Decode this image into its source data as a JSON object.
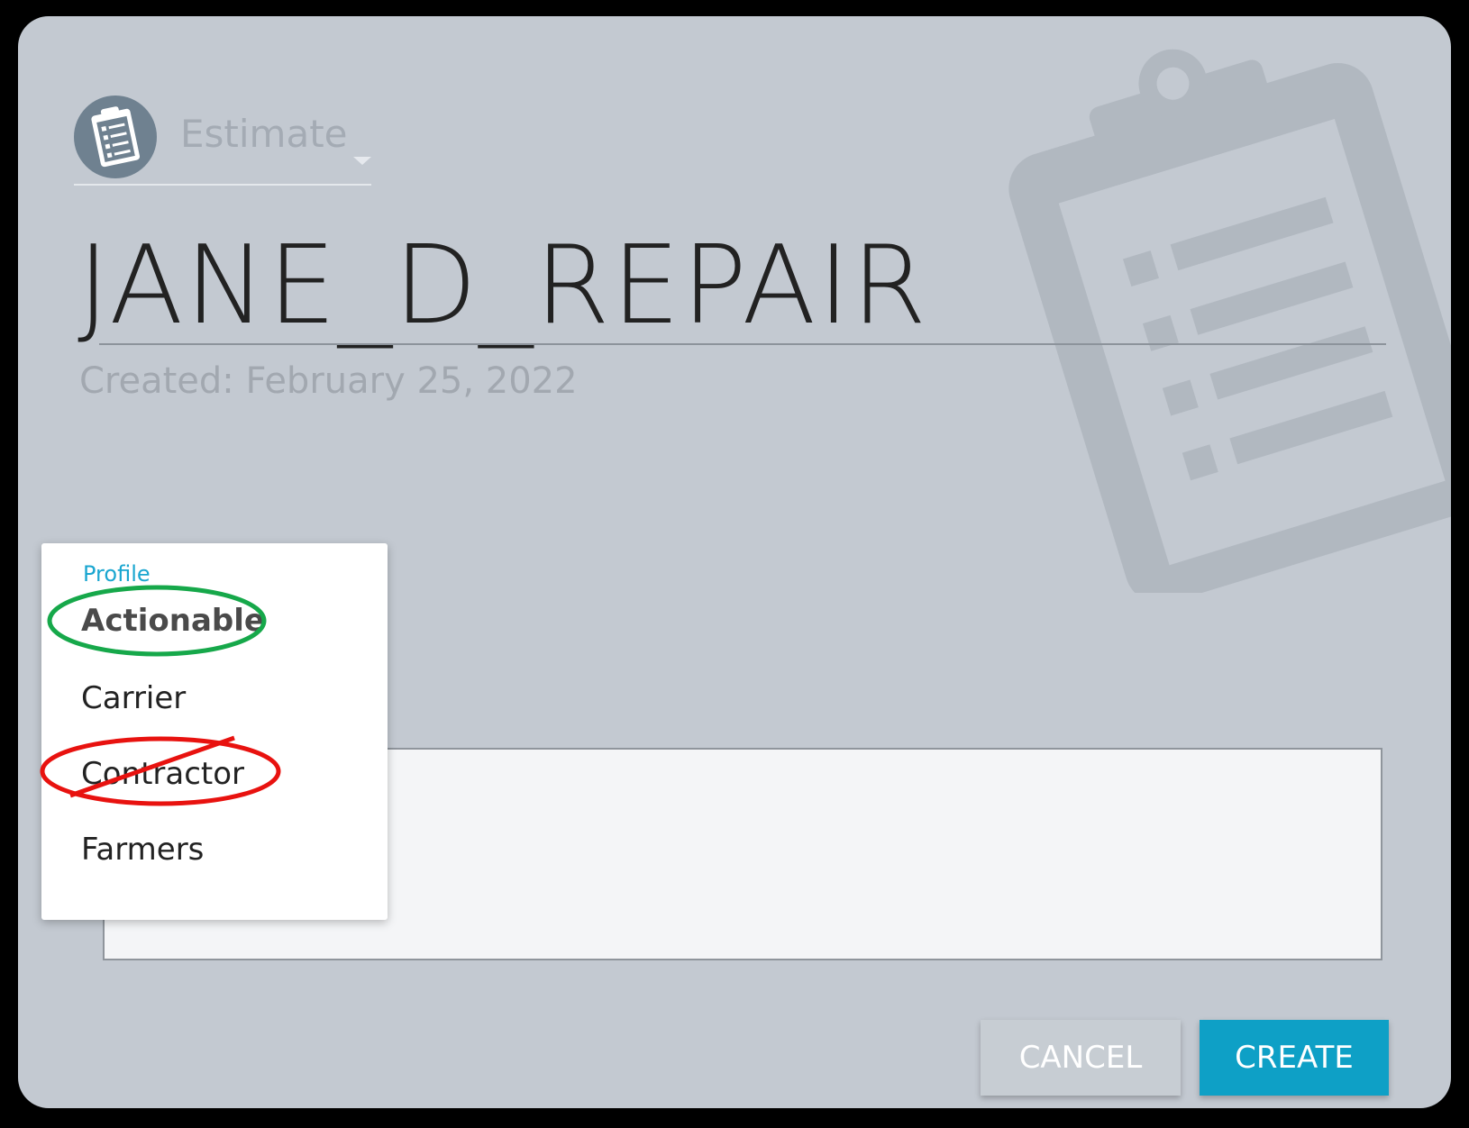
{
  "header": {
    "type_label": "Estimate",
    "type_icon": "clipboard-icon"
  },
  "estimate": {
    "name": "JANE_D_REPAIR",
    "created": "Created: February 25, 2022"
  },
  "profile_dropdown": {
    "label": "Profile",
    "selected": "Actionable",
    "items": [
      {
        "label": "Actionable",
        "annotation": "green-circle"
      },
      {
        "label": "Carrier"
      },
      {
        "label": "Contractor",
        "annotation": "red-strikethrough-circle"
      },
      {
        "label": "Farmers"
      }
    ]
  },
  "actions": {
    "cancel_label": "CANCEL",
    "create_label": "CREATE"
  },
  "colors": {
    "dialog_bg": "#c3c9d1",
    "accent": "#0ea0c6",
    "annotation_green": "#16a84a",
    "annotation_red": "#e8120f"
  }
}
